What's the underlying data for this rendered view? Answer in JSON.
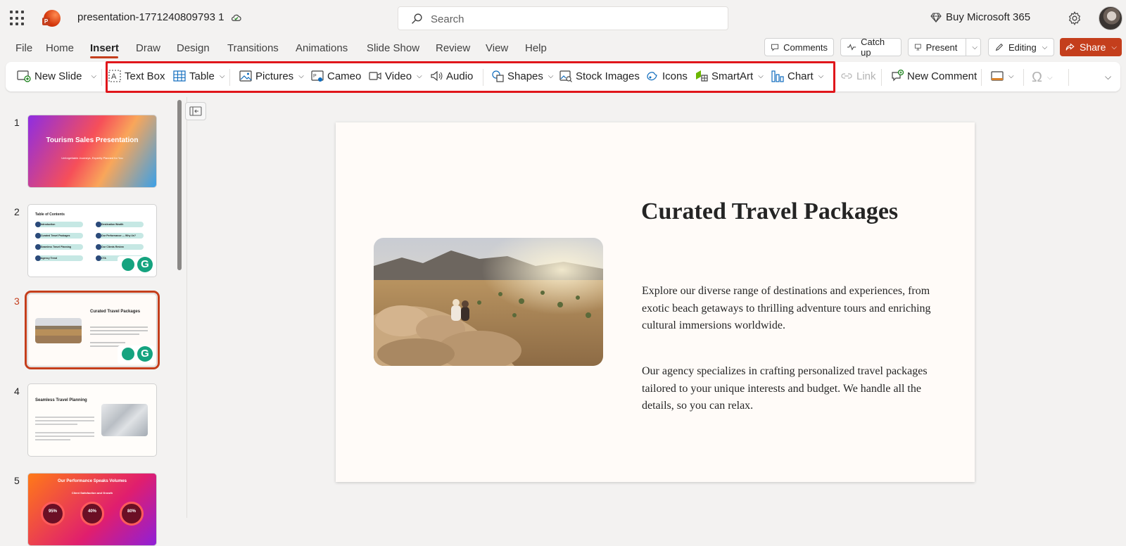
{
  "app": {
    "title": "presentation-1771240809793 1",
    "search_placeholder": "Search",
    "buy_label": "Buy Microsoft 365"
  },
  "menu": {
    "tabs": [
      "File",
      "Home",
      "Insert",
      "Draw",
      "Design",
      "Transitions",
      "Animations",
      "Slide Show",
      "Review",
      "View",
      "Help"
    ],
    "active_tab": "Insert"
  },
  "actions": {
    "comments": "Comments",
    "catch_up": "Catch up",
    "present": "Present",
    "editing": "Editing",
    "share": "Share"
  },
  "ribbon": {
    "new_slide": "New Slide",
    "text_box": "Text Box",
    "table": "Table",
    "pictures": "Pictures",
    "cameo": "Cameo",
    "video": "Video",
    "audio": "Audio",
    "shapes": "Shapes",
    "stock_images": "Stock Images",
    "icons": "Icons",
    "smartart": "SmartArt",
    "chart": "Chart",
    "link": "Link",
    "new_comment": "New Comment"
  },
  "thumbnails": [
    {
      "number": "1",
      "title": "Tourism Sales Presentation",
      "subtitle": "Unforgettable Journeys, Expertly Planned for You"
    },
    {
      "number": "2",
      "title": "Table of Contents",
      "items": [
        "Introduction",
        "Curated Travel Packages",
        "Seamless Travel Planning",
        "Agency Trend",
        "Destination Wealth",
        "Our Performance — Why Us?",
        "Our Clients Review",
        "CTA"
      ]
    },
    {
      "number": "3",
      "title": "Curated Travel Packages"
    },
    {
      "number": "4",
      "title": "Seamless Travel Planning"
    },
    {
      "number": "5",
      "title": "Our Performance Speaks Volumes",
      "subtitle": "Client Satisfaction and Growth",
      "stats": [
        "95%",
        "40%",
        "80%"
      ]
    }
  ],
  "slide": {
    "title": "Curated Travel Packages",
    "paragraph1": "Explore our diverse range of destinations and experiences, from exotic beach getaways to thrilling adventure tours and enriching cultural immersions worldwide.",
    "paragraph2": "Our agency specializes in crafting personalized travel packages tailored to your unique interests and budget. We handle all the details, so you can relax."
  },
  "colors": {
    "accent": "#c43e1c",
    "highlight_box": "#e0161b"
  }
}
